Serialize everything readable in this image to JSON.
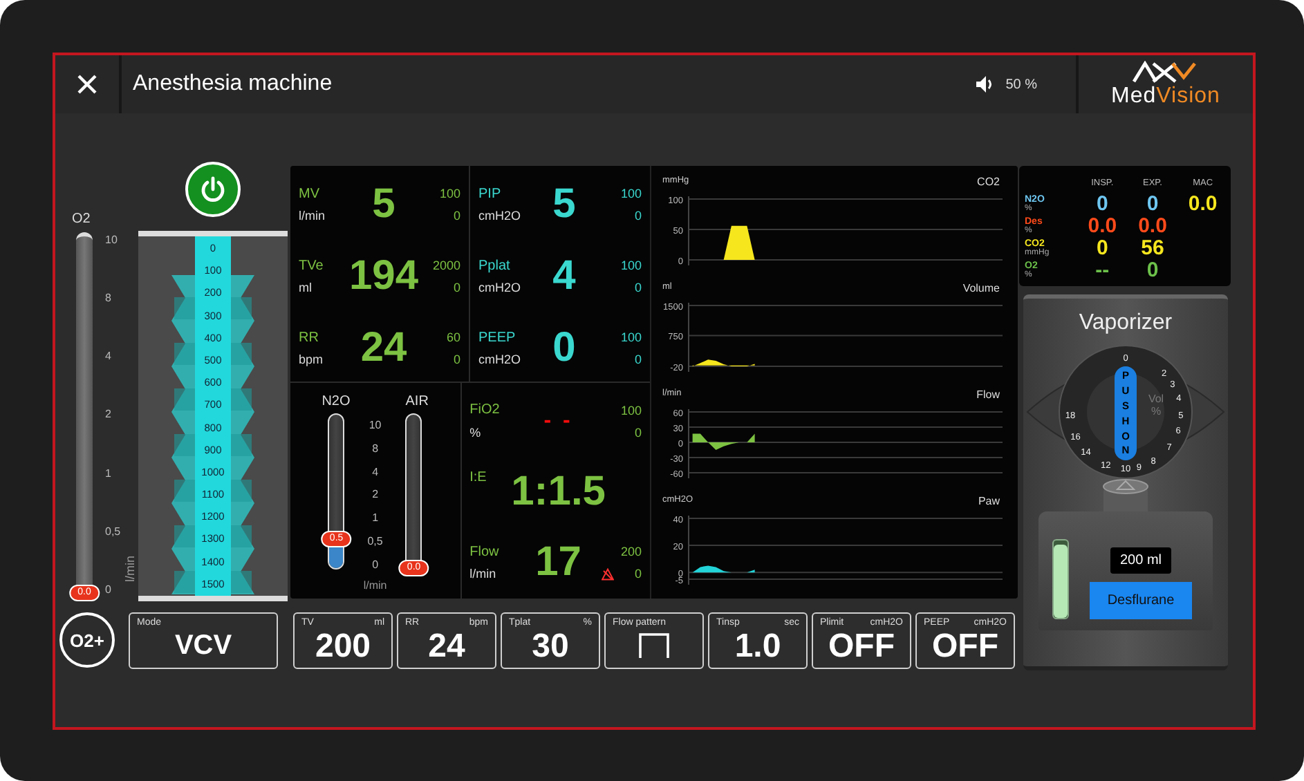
{
  "header": {
    "title": "Anesthesia machine",
    "volume": "50 %",
    "logo": {
      "first": "Med",
      "second": "Vision"
    }
  },
  "o2_flow": {
    "label": "O2",
    "unit": "l/min",
    "scale": [
      "10",
      "8",
      "4",
      "2",
      "1",
      "0,5",
      "0"
    ],
    "reading": "0.0",
    "level": 0
  },
  "bellows": {
    "scale": [
      "0",
      "100",
      "200",
      "300",
      "400",
      "500",
      "600",
      "700",
      "800",
      "900",
      "1000",
      "1100",
      "1200",
      "1300",
      "1400",
      "1500"
    ]
  },
  "parameters": [
    {
      "label": "MV",
      "unit": "l/min",
      "value": "5",
      "high": "100",
      "low": "0",
      "color": "#7dc242"
    },
    {
      "label": "PIP",
      "unit": "cmH2O",
      "value": "5",
      "high": "100",
      "low": "0",
      "color": "#3ad8cf"
    },
    {
      "label": "TVe",
      "unit": "ml",
      "value": "194",
      "high": "2000",
      "low": "0",
      "color": "#7dc242"
    },
    {
      "label": "Pplat",
      "unit": "cmH2O",
      "value": "4",
      "high": "100",
      "low": "0",
      "color": "#3ad8cf"
    },
    {
      "label": "RR",
      "unit": "bpm",
      "value": "24",
      "high": "60",
      "low": "0",
      "color": "#7dc242"
    },
    {
      "label": "PEEP",
      "unit": "cmH2O",
      "value": "0",
      "high": "100",
      "low": "0",
      "color": "#3ad8cf"
    }
  ],
  "gas_flows": {
    "unit": "l/min",
    "scale": [
      "10",
      "8",
      "4",
      "2",
      "1",
      "0,5",
      "0"
    ],
    "gauges": [
      {
        "label": "N2O",
        "reading": "0.5",
        "level": 0.2
      },
      {
        "label": "AIR",
        "reading": "0.0",
        "level": 0
      }
    ]
  },
  "lower_parameters": [
    {
      "kind": "limits",
      "label": "FiO2",
      "unit": "%",
      "value": "- -",
      "high": "100",
      "low": "0",
      "invalid": true,
      "alarm_silenced": false
    },
    {
      "kind": "ratio",
      "label": "I:E",
      "value": "1:1.5",
      "invalid": false,
      "alarm_silenced": false
    },
    {
      "kind": "limits",
      "label": "Flow",
      "unit": "l/min",
      "value": "17",
      "high": "200",
      "low": "0",
      "invalid": false,
      "alarm_silenced": true
    }
  ],
  "waveforms": [
    {
      "chart_data": {
        "type": "area",
        "grid": true,
        "ylabel": "mmHg",
        "categories": [
          null,
          null,
          null,
          null,
          null,
          null,
          null,
          null,
          null,
          null,
          null,
          null,
          null,
          null,
          null,
          null,
          null,
          null,
          null,
          null,
          null,
          null,
          null,
          null,
          null,
          null,
          null,
          null,
          null,
          null,
          null,
          null,
          null,
          null,
          null,
          null,
          null,
          null,
          null,
          null
        ],
        "ylim": [
          0,
          100
        ],
        "yticks": [
          0,
          50,
          100
        ],
        "series": [
          {
            "name": "CO2",
            "color": "#f5e61e",
            "values": [
              0,
              0,
              0,
              0,
              0,
              56,
              56,
              56,
              0,
              null,
              null,
              null,
              null,
              null,
              null,
              null,
              null,
              null,
              null,
              null,
              null,
              null,
              null,
              null,
              null,
              null,
              null,
              null,
              null,
              null,
              null,
              null,
              null,
              null,
              null,
              null,
              null,
              null,
              null,
              null
            ]
          }
        ]
      }
    },
    {
      "chart_data": {
        "type": "area",
        "grid": true,
        "ylabel": "ml",
        "categories": [
          null,
          null,
          null,
          null,
          null,
          null,
          null,
          null,
          null,
          null,
          null,
          null,
          null,
          null,
          null,
          null,
          null,
          null,
          null,
          null,
          null,
          null,
          null,
          null,
          null,
          null,
          null,
          null,
          null,
          null,
          null,
          null,
          null,
          null,
          null,
          null,
          null,
          null,
          null,
          null
        ],
        "ylim": [
          -20,
          1500
        ],
        "yticks": [
          -20,
          750,
          1500
        ],
        "series": [
          {
            "name": "Volume",
            "color": "#f5e61e",
            "values": [
              -20,
              60,
              150,
              120,
              30,
              -20,
              -20,
              -20,
              40,
              null,
              null,
              null,
              null,
              null,
              null,
              null,
              null,
              null,
              null,
              null,
              null,
              null,
              null,
              null,
              null,
              null,
              null,
              null,
              null,
              null,
              null,
              null,
              null,
              null,
              null,
              null,
              null,
              null,
              null,
              null
            ]
          }
        ]
      }
    },
    {
      "chart_data": {
        "type": "area",
        "grid": true,
        "ylabel": "l/min",
        "categories": [
          null,
          null,
          null,
          null,
          null,
          null,
          null,
          null,
          null,
          null,
          null,
          null,
          null,
          null,
          null,
          null,
          null,
          null,
          null,
          null,
          null,
          null,
          null,
          null,
          null,
          null,
          null,
          null,
          null,
          null,
          null,
          null,
          null,
          null,
          null,
          null,
          null,
          null,
          null,
          null
        ],
        "ylim": [
          -60,
          60
        ],
        "yticks": [
          -60,
          -30,
          0,
          30,
          60
        ],
        "series": [
          {
            "name": "Flow",
            "color": "#7dc242",
            "values": [
              17,
              17,
              0,
              -15,
              -8,
              -3,
              0,
              0,
              17,
              null,
              null,
              null,
              null,
              null,
              null,
              null,
              null,
              null,
              null,
              null,
              null,
              null,
              null,
              null,
              null,
              null,
              null,
              null,
              null,
              null,
              null,
              null,
              null,
              null,
              null,
              null,
              null,
              null,
              null,
              null
            ]
          }
        ]
      }
    },
    {
      "chart_data": {
        "type": "area",
        "grid": true,
        "ylabel": "cmH2O",
        "categories": [
          null,
          null,
          null,
          null,
          null,
          null,
          null,
          null,
          null,
          null,
          null,
          null,
          null,
          null,
          null,
          null,
          null,
          null,
          null,
          null,
          null,
          null,
          null,
          null,
          null,
          null,
          null,
          null,
          null,
          null,
          null,
          null,
          null,
          null,
          null,
          null,
          null,
          null,
          null,
          null
        ],
        "ylim": [
          -5,
          40
        ],
        "yticks": [
          -5,
          0,
          20,
          40
        ],
        "series": [
          {
            "name": "Paw",
            "color": "#22d3d8",
            "values": [
              0,
              4,
              5,
              4,
              1,
              0,
              0,
              0,
              2,
              null,
              null,
              null,
              null,
              null,
              null,
              null,
              null,
              null,
              null,
              null,
              null,
              null,
              null,
              null,
              null,
              null,
              null,
              null,
              null,
              null,
              null,
              null,
              null,
              null,
              null,
              null,
              null,
              null,
              null,
              null
            ]
          }
        ]
      }
    }
  ],
  "gas_monitor": {
    "columns": [
      "INSP.",
      "EXP.",
      "MAC"
    ],
    "rows": [
      {
        "name": "N2O",
        "unit": "%",
        "color": "#6ec6f0",
        "values": [
          "0",
          "0",
          "0.0"
        ]
      },
      {
        "name": "Des",
        "unit": "%",
        "color": "#ff4a1a",
        "values": [
          "0.0",
          "0.0"
        ]
      },
      {
        "name": "CO2",
        "unit": "mmHg",
        "color": "#f5e61e",
        "values": [
          "0",
          "56"
        ]
      },
      {
        "name": "O2",
        "unit": "%",
        "color": "#6cc04a",
        "values": [
          "--",
          "0"
        ]
      }
    ]
  },
  "vaporizer": {
    "title": "Vaporizer",
    "dial_labels": [
      "0",
      "2",
      "3",
      "4",
      "18",
      "5",
      "16",
      "6",
      "14",
      "7",
      "12",
      "10",
      "9",
      "8"
    ],
    "push_label": "PUSHON",
    "dial_unit": "Vol %",
    "tank": {
      "level": 0.95
    },
    "fill": "200 ml",
    "agent": "Desflurane"
  },
  "o2_flush": "O2+",
  "mode": {
    "label": "Mode",
    "value": "VCV"
  },
  "settings": [
    {
      "kind": "value",
      "label": "TV",
      "unit": "ml",
      "value": "200"
    },
    {
      "kind": "value",
      "label": "RR",
      "unit": "bpm",
      "value": "24"
    },
    {
      "kind": "value",
      "label": "Tplat",
      "unit": "%",
      "value": "30"
    },
    {
      "kind": "pattern",
      "label": "Flow pattern"
    },
    {
      "kind": "value",
      "label": "Tinsp",
      "unit": "sec",
      "value": "1.0"
    },
    {
      "kind": "value",
      "label": "Plimit",
      "unit": "cmH2O",
      "value": "OFF"
    },
    {
      "kind": "value",
      "label": "PEEP",
      "unit": "cmH2O",
      "value": "OFF"
    }
  ]
}
